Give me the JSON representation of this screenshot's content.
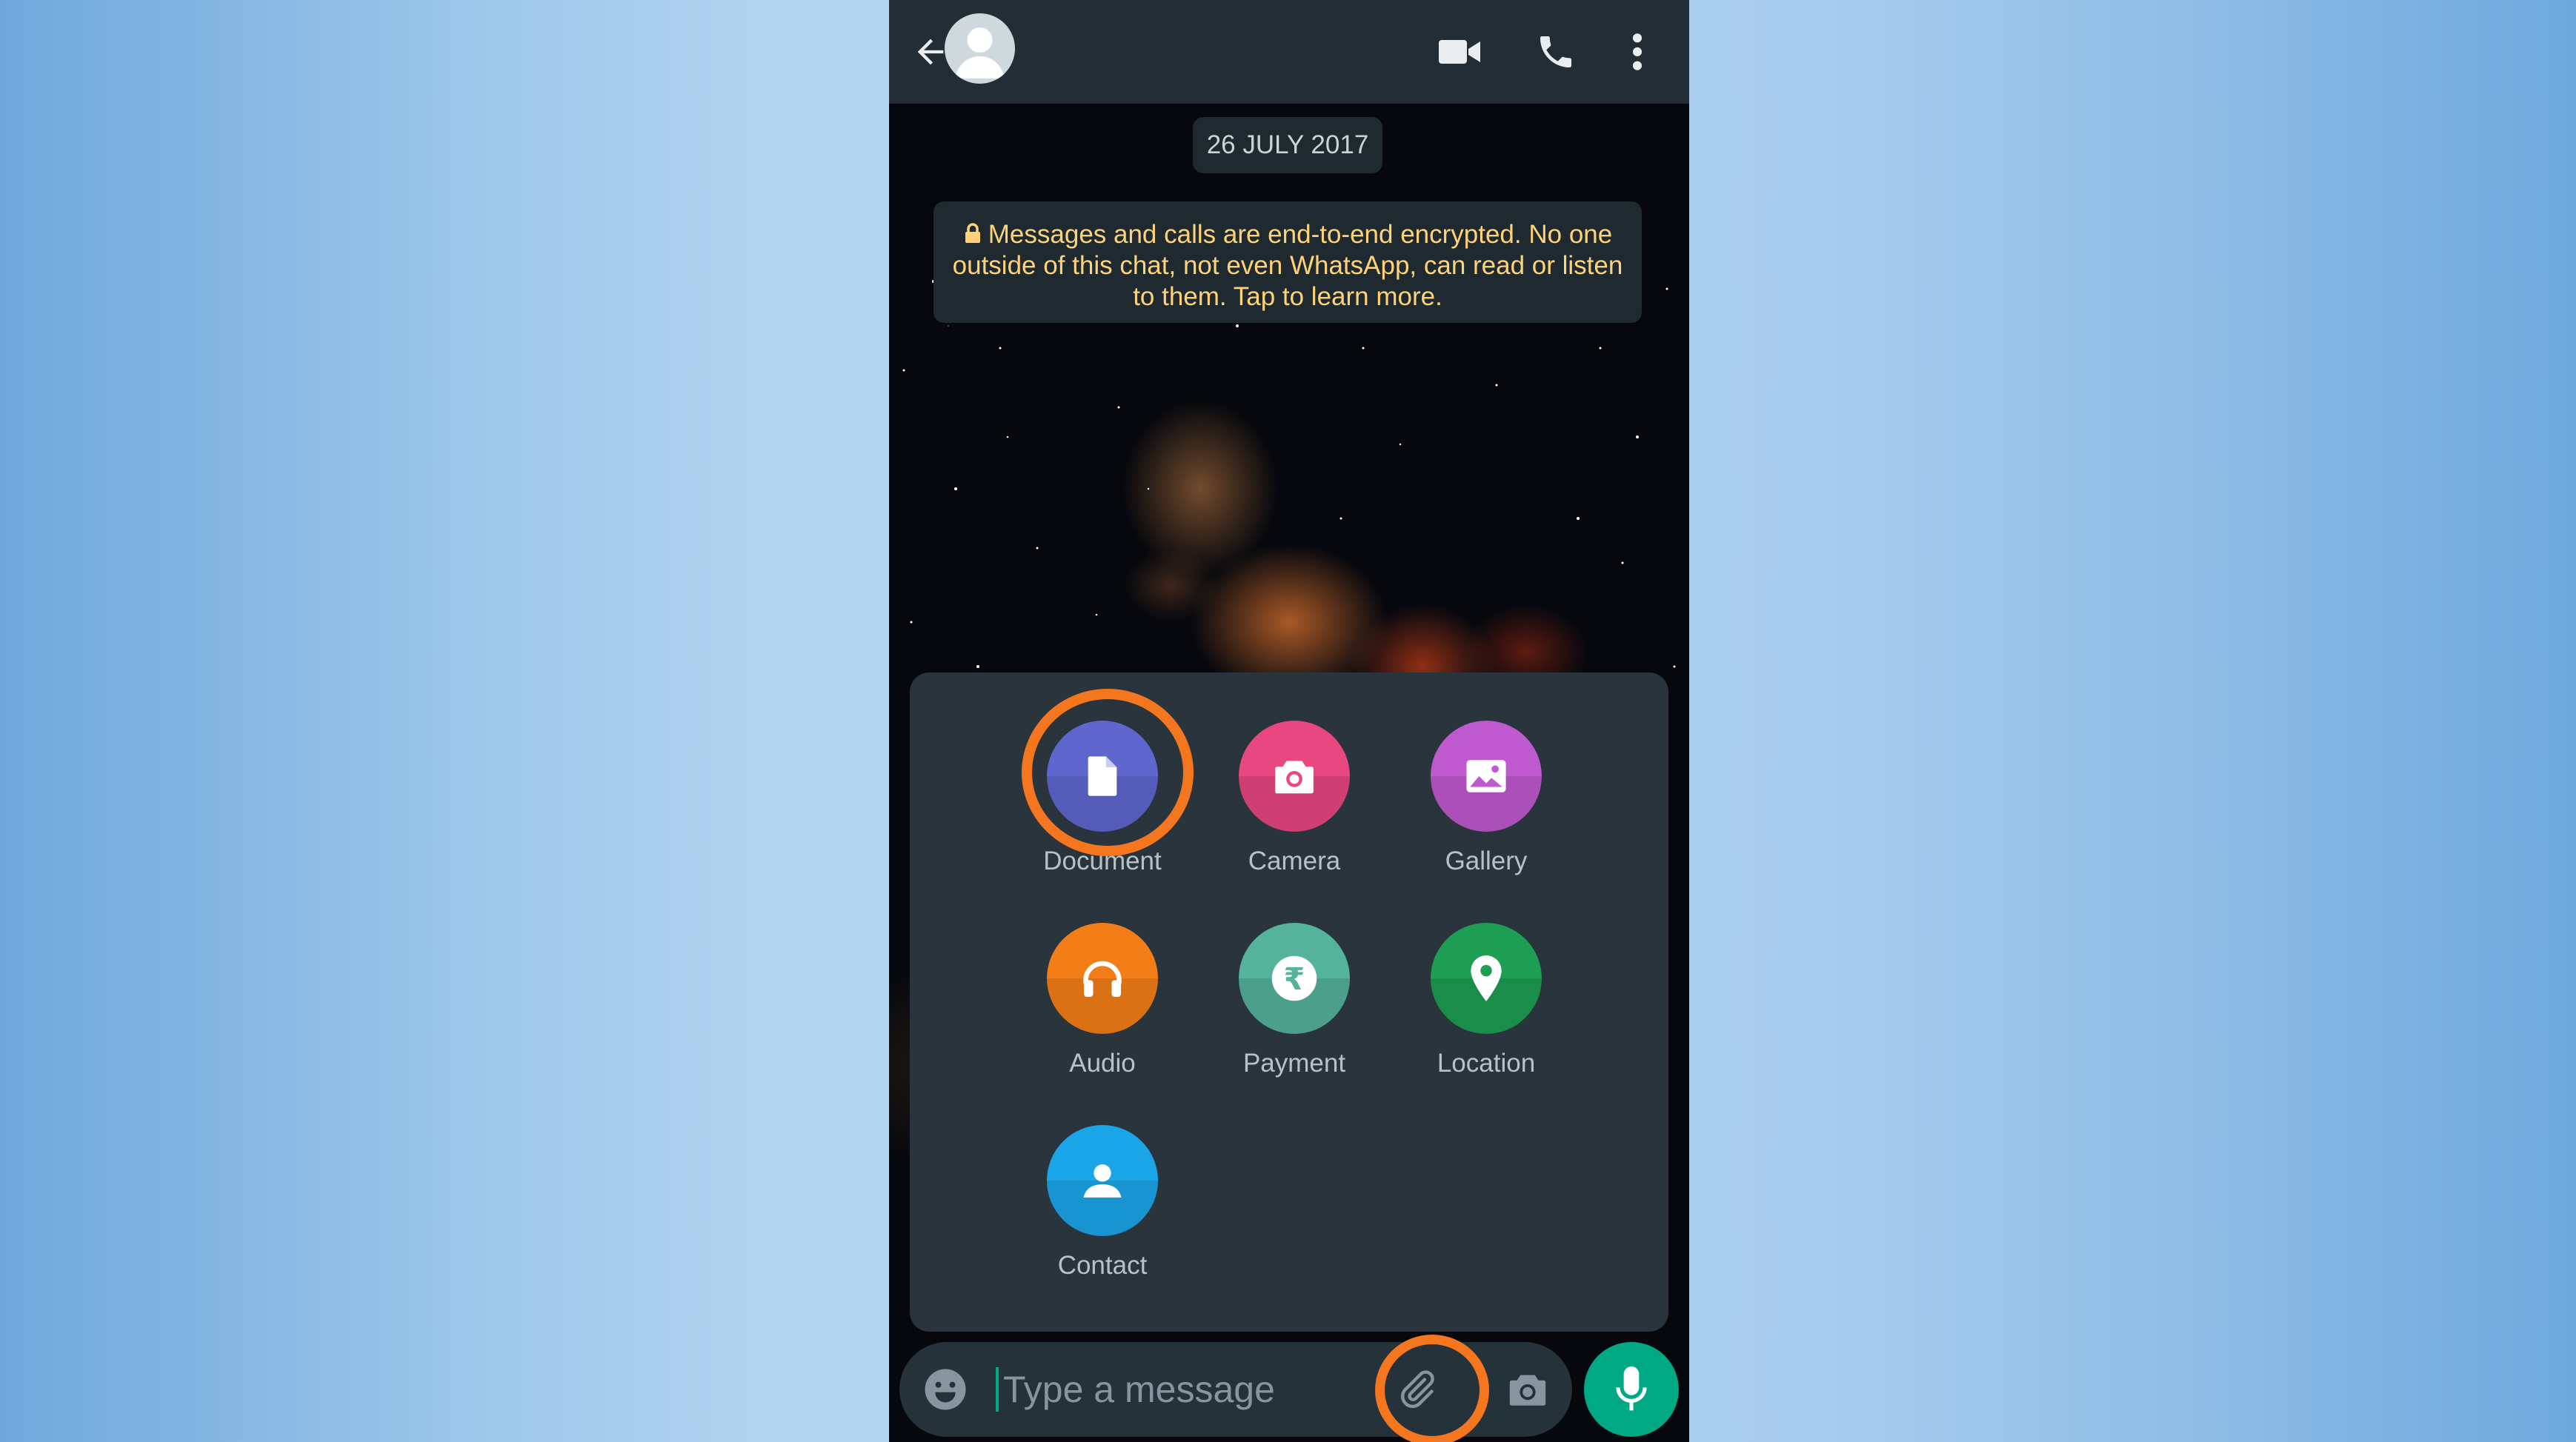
{
  "chat": {
    "date_chip": "26 JULY 2017",
    "encryption_notice": "Messages and calls are end-to-end encrypted. No one outside of this chat, not even WhatsApp, can read or listen to them. Tap to learn more."
  },
  "header": {
    "icons": [
      "back-arrow-icon",
      "avatar",
      "video-call-icon",
      "voice-call-icon",
      "more-options-icon"
    ]
  },
  "attach_menu": {
    "items": [
      {
        "label": "Document",
        "icon": "document-icon",
        "color": "#5f66cd"
      },
      {
        "label": "Camera",
        "icon": "camera-icon",
        "color": "#e8477f"
      },
      {
        "label": "Gallery",
        "icon": "gallery-icon",
        "color": "#bf59cf"
      },
      {
        "label": "Audio",
        "icon": "headphones-icon",
        "color": "#f37e18"
      },
      {
        "label": "Payment",
        "icon": "rupee-icon",
        "color": "#55b39b"
      },
      {
        "label": "Location",
        "icon": "location-pin-icon",
        "color": "#1e9e53"
      },
      {
        "label": "Contact",
        "icon": "contact-icon",
        "color": "#1ba5e9"
      }
    ],
    "highlighted_item": "Document"
  },
  "composer": {
    "placeholder": "Type a message",
    "value": ""
  },
  "colors": {
    "accent": "#00a884",
    "highlight_ring": "#f4761f",
    "header_bg": "#232d36",
    "panel_bg": "#2a343c"
  }
}
